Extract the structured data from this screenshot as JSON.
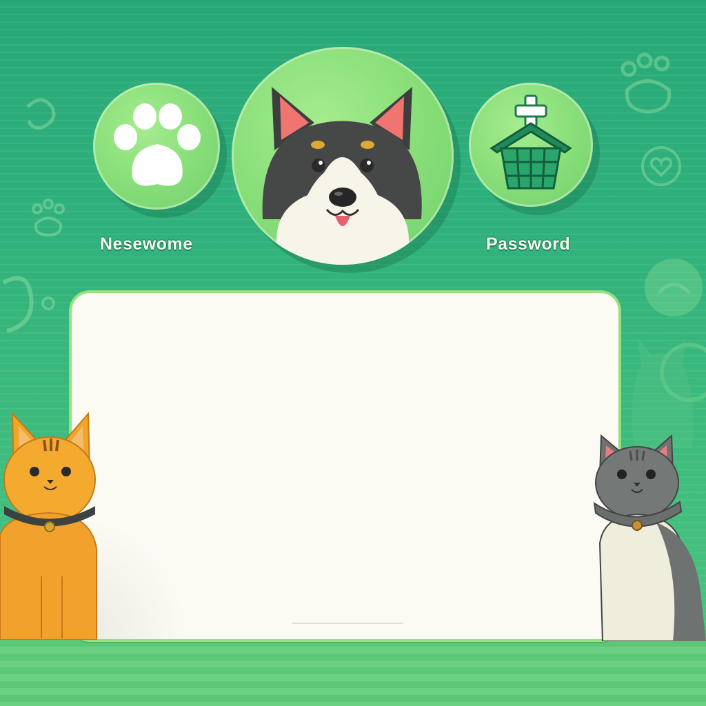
{
  "nav": {
    "left_label": "Nesewome",
    "right_label": "Password"
  },
  "icons": {
    "left": "paw-icon",
    "center": "dog-avatar",
    "right": "pet-house-add-icon"
  },
  "colors": {
    "background": "#2fb07c",
    "circle": "#86dd78",
    "panel": "#fbfbf4",
    "panel_border": "#95e07f"
  }
}
